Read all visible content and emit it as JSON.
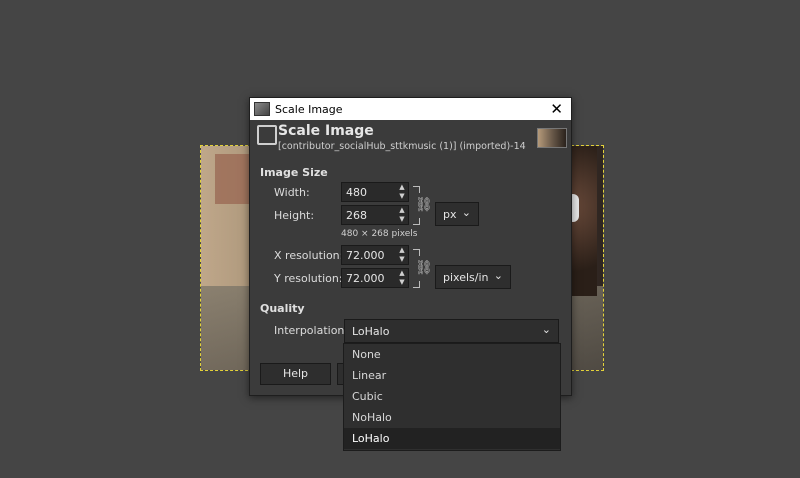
{
  "window_title": "Scale Image",
  "header": {
    "title": "Scale Image",
    "subtitle": "[contributor_socialHub_sttkmusic (1)] (imported)-14"
  },
  "image_size": {
    "section_label": "Image Size",
    "width_label": "Width:",
    "width_value": "480",
    "height_label": "Height:",
    "height_value": "268",
    "unit": "px",
    "pixel_summary": "480 × 268 pixels",
    "xres_label": "X resolution:",
    "xres_value": "72.000",
    "yres_label": "Y resolution:",
    "yres_value": "72.000",
    "res_unit": "pixels/in"
  },
  "quality": {
    "section_label": "Quality",
    "interp_label": "Interpolation:",
    "interp_value": "LoHalo",
    "options": [
      "None",
      "Linear",
      "Cubic",
      "NoHalo",
      "LoHalo"
    ],
    "selected_option": "LoHalo"
  },
  "buttons": {
    "help": "Help"
  },
  "icons": {
    "close": "close-icon",
    "chain": "chain-link-icon",
    "dropdown": "chevron-down-icon"
  }
}
